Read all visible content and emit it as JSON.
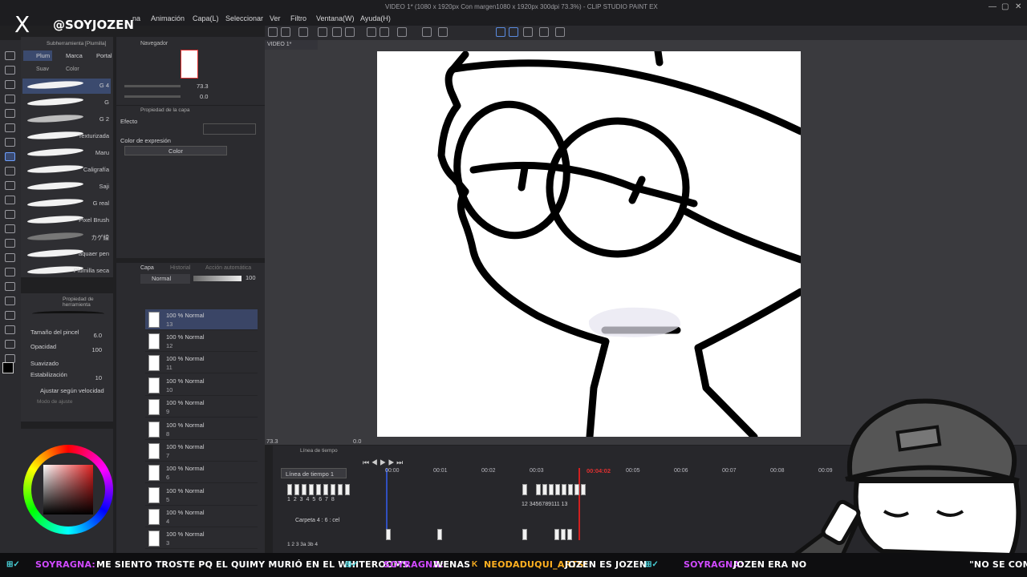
{
  "app": {
    "window_title": "VIDEO 1* (1080 x 1920px Con margen1080 x 1920px 300dpi 73.3%) - CLIP STUDIO PAINT EX",
    "menu": [
      "na",
      "Animación",
      "Capa(L)",
      "Seleccionar",
      "Ver",
      "Filtro",
      "Ventana(W)",
      "Ayuda(H)"
    ]
  },
  "overlay": {
    "handle": "@SOYJOZEN",
    "x_logo": "X"
  },
  "subtool": {
    "header": "Subherramienta [Plumilla]",
    "tabs": [
      "Plum",
      "Marca",
      "Portal"
    ],
    "tabs2": [
      "Suav",
      "Color"
    ],
    "brushes": [
      {
        "label": "G 4"
      },
      {
        "label": "G"
      },
      {
        "label": "G 2"
      },
      {
        "label": "Texturizada"
      },
      {
        "label": "Maru"
      },
      {
        "label": "Caligrafía"
      },
      {
        "label": "Saji"
      },
      {
        "label": "G real"
      },
      {
        "label": "Pixel Brush"
      },
      {
        "label": "カゲ線"
      },
      {
        "label": "aquaer pen"
      },
      {
        "label": "Plumilla seca"
      }
    ]
  },
  "navigator": {
    "tab": "Navegador",
    "zoom": "73.3",
    "angle": "0.0"
  },
  "layer_property": {
    "tab": "Propiedad de la capa",
    "effect_label": "Efecto",
    "expression_label": "Color de expresión",
    "expression_value": "Color"
  },
  "layer_panel": {
    "tabs": [
      "Capa",
      "Historial",
      "Acción automática"
    ],
    "blend_mode": "Normal",
    "opacity": "100",
    "layers": [
      {
        "name": "100 % Normal",
        "num": "13"
      },
      {
        "name": "100 % Normal",
        "num": "12"
      },
      {
        "name": "100 % Normal",
        "num": "11"
      },
      {
        "name": "100 % Normal",
        "num": "10"
      },
      {
        "name": "100 % Normal",
        "num": "9"
      },
      {
        "name": "100 % Normal",
        "num": "8"
      },
      {
        "name": "100 % Normal",
        "num": "7"
      },
      {
        "name": "100 % Normal",
        "num": "6"
      },
      {
        "name": "100 % Normal",
        "num": "5"
      },
      {
        "name": "100 % Normal",
        "num": "4"
      },
      {
        "name": "100 % Normal",
        "num": "3"
      }
    ]
  },
  "tool_property": {
    "tab": "Propiedad de herramienta",
    "brush_size_label": "Tamaño del pincel",
    "brush_size_value": "6.0",
    "opacity_label": "Opacidad",
    "opacity_value": "100",
    "smoothing_label": "Suavizado",
    "stabilization_label": "Estabilización",
    "stabilization_value": "10",
    "speed_label": "Ajustar según velocidad",
    "snap_label": "Modo de ajuste"
  },
  "canvas": {
    "tab": "VIDEO 1*",
    "zoom_readout": "73.3",
    "angle_readout": "0.0"
  },
  "timeline": {
    "tab": "Línea de tiempo",
    "track_select": "Línea de tiempo 1",
    "folder": "Carpeta 4 : 6 : cel",
    "playhead_time": "00:04:02",
    "seconds": [
      "00:00",
      "00:01",
      "00:02",
      "00:03",
      "00:05",
      "00:06",
      "00:07",
      "00:08",
      "00:09"
    ],
    "cel_numbers_left": "1 2 3 4 5 6 7 8",
    "cel_numbers_right": "12   3456789111 13",
    "folder_numbers": "1 2 3 3a 3b 4"
  },
  "chat": [
    {
      "user": "SOYRAGNA:",
      "text": "ME SIENTO TROSTE PQ EL QUIMY MURIÓ EN EL WHITEROOMS",
      "color": "#d14aff"
    },
    {
      "user": "SOYRAGNA:",
      "text": "WENAS",
      "color": "#d14aff"
    },
    {
      "user": "NEODADUQUI_ARTS:",
      "text": "JOZEN ES JOZEN",
      "color": "#ffb020"
    },
    {
      "user": "SOYRAGNA:",
      "text": "JOZEN ERA NO",
      "color": "#d14aff"
    },
    {
      "user": "",
      "text": "\"NO SE COMO",
      "color": "#ffffff"
    }
  ]
}
